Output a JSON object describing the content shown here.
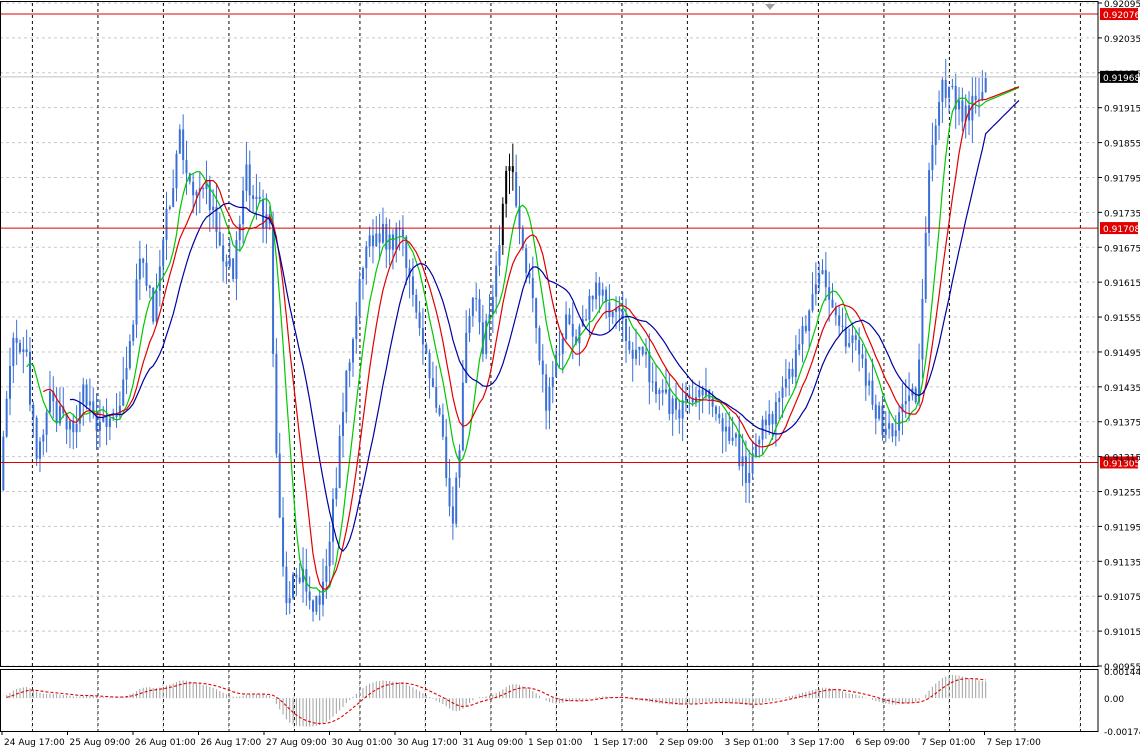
{
  "chart_data": {
    "type": "candlestick",
    "price_axis": {
      "ylim": [
        0.90955,
        0.92095
      ],
      "ticks": [
        "0.92095",
        "0.92035",
        "0.91975",
        "0.91915",
        "0.91855",
        "0.91795",
        "0.91735",
        "0.91675",
        "0.91615",
        "0.91555",
        "0.91495",
        "0.91435",
        "0.91375",
        "0.91315",
        "0.91255",
        "0.91195",
        "0.91135",
        "0.91075",
        "0.91015",
        "0.90955"
      ]
    },
    "time_axis": {
      "labels": [
        "24 Aug 17:00",
        "25 Aug 09:00",
        "26 Aug 01:00",
        "26 Aug 17:00",
        "27 Aug 09:00",
        "30 Aug 01:00",
        "30 Aug 17:00",
        "31 Aug 09:00",
        "1 Sep 01:00",
        "1 Sep 17:00",
        "2 Sep 09:00",
        "3 Sep 01:00",
        "3 Sep 17:00",
        "6 Sep 09:00",
        "7 Sep 01:00",
        "7 Sep 17:00"
      ]
    },
    "horizontal_levels": [
      {
        "value": 0.92076,
        "label": "0.92076",
        "color": "#e00000"
      },
      {
        "value": 0.91708,
        "label": "0.91708",
        "color": "#e00000"
      },
      {
        "value": 0.91305,
        "label": "0.91305",
        "color": "#e00000"
      }
    ],
    "current_price": {
      "value": 0.91968,
      "label": "0.91968"
    },
    "price_anchors": [
      [
        0,
        0.9128
      ],
      [
        2,
        0.914
      ],
      [
        4,
        0.915
      ],
      [
        8,
        0.9148
      ],
      [
        11,
        0.913
      ],
      [
        15,
        0.9141
      ],
      [
        18,
        0.9138
      ],
      [
        22,
        0.9135
      ],
      [
        24,
        0.9143
      ],
      [
        27,
        0.9141
      ],
      [
        30,
        0.9136
      ],
      [
        34,
        0.9138
      ],
      [
        38,
        0.9145
      ],
      [
        42,
        0.9166
      ],
      [
        46,
        0.9156
      ],
      [
        50,
        0.9172
      ],
      [
        54,
        0.9187
      ],
      [
        58,
        0.9175
      ],
      [
        62,
        0.9178
      ],
      [
        66,
        0.9168
      ],
      [
        70,
        0.9162
      ],
      [
        74,
        0.918
      ],
      [
        78,
        0.9174
      ],
      [
        81,
        0.9171
      ],
      [
        83,
        0.913
      ],
      [
        86,
        0.9106
      ],
      [
        90,
        0.9112
      ],
      [
        94,
        0.9104
      ],
      [
        97,
        0.9108
      ],
      [
        100,
        0.9122
      ],
      [
        103,
        0.914
      ],
      [
        106,
        0.9152
      ],
      [
        110,
        0.9168
      ],
      [
        114,
        0.917
      ],
      [
        118,
        0.9168
      ],
      [
        120,
        0.9172
      ],
      [
        124,
        0.916
      ],
      [
        128,
        0.915
      ],
      [
        131,
        0.914
      ],
      [
        134,
        0.913
      ],
      [
        136,
        0.912
      ],
      [
        138,
        0.9132
      ],
      [
        140,
        0.9152
      ],
      [
        142,
        0.916
      ],
      [
        145,
        0.915
      ],
      [
        148,
        0.916
      ],
      [
        150,
        0.917
      ],
      [
        152,
        0.918
      ],
      [
        154,
        0.9182
      ],
      [
        156,
        0.917
      ],
      [
        158,
        0.9165
      ],
      [
        160,
        0.916
      ],
      [
        162,
        0.915
      ],
      [
        164,
        0.914
      ],
      [
        166,
        0.9145
      ],
      [
        170,
        0.9155
      ],
      [
        174,
        0.9152
      ],
      [
        178,
        0.916
      ],
      [
        182,
        0.9158
      ],
      [
        186,
        0.9155
      ],
      [
        190,
        0.915
      ],
      [
        194,
        0.9148
      ],
      [
        198,
        0.9142
      ],
      [
        202,
        0.914
      ],
      [
        206,
        0.914
      ],
      [
        210,
        0.9143
      ],
      [
        214,
        0.9141
      ],
      [
        218,
        0.9136
      ],
      [
        221,
        0.9134
      ],
      [
        224,
        0.9128
      ],
      [
        227,
        0.9132
      ],
      [
        230,
        0.9138
      ],
      [
        234,
        0.914
      ],
      [
        238,
        0.9147
      ],
      [
        242,
        0.9155
      ],
      [
        245,
        0.916
      ],
      [
        248,
        0.9162
      ],
      [
        251,
        0.9158
      ],
      [
        254,
        0.9152
      ],
      [
        257,
        0.915
      ],
      [
        260,
        0.9145
      ],
      [
        263,
        0.914
      ],
      [
        266,
        0.9135
      ],
      [
        269,
        0.9138
      ],
      [
        272,
        0.9143
      ],
      [
        275,
        0.914
      ],
      [
        277,
        0.916
      ],
      [
        279,
        0.918
      ],
      [
        281,
        0.919
      ],
      [
        283,
        0.9195
      ],
      [
        286,
        0.9194
      ],
      [
        289,
        0.919
      ],
      [
        292,
        0.9192
      ],
      [
        294,
        0.9195
      ]
    ],
    "moving_averages": [
      {
        "color": "#00c800",
        "period": 8
      },
      {
        "color": "#e00000",
        "period": 13
      },
      {
        "color": "#0000a0",
        "period": 21
      }
    ],
    "oscillator": {
      "type": "histogram",
      "ticks": [
        "0.00144",
        "0.00",
        "-0.00174"
      ],
      "ylim": [
        -0.00174,
        0.00144
      ],
      "signal_color": "#e00000",
      "histogram_color": "#a0a0a0"
    }
  }
}
